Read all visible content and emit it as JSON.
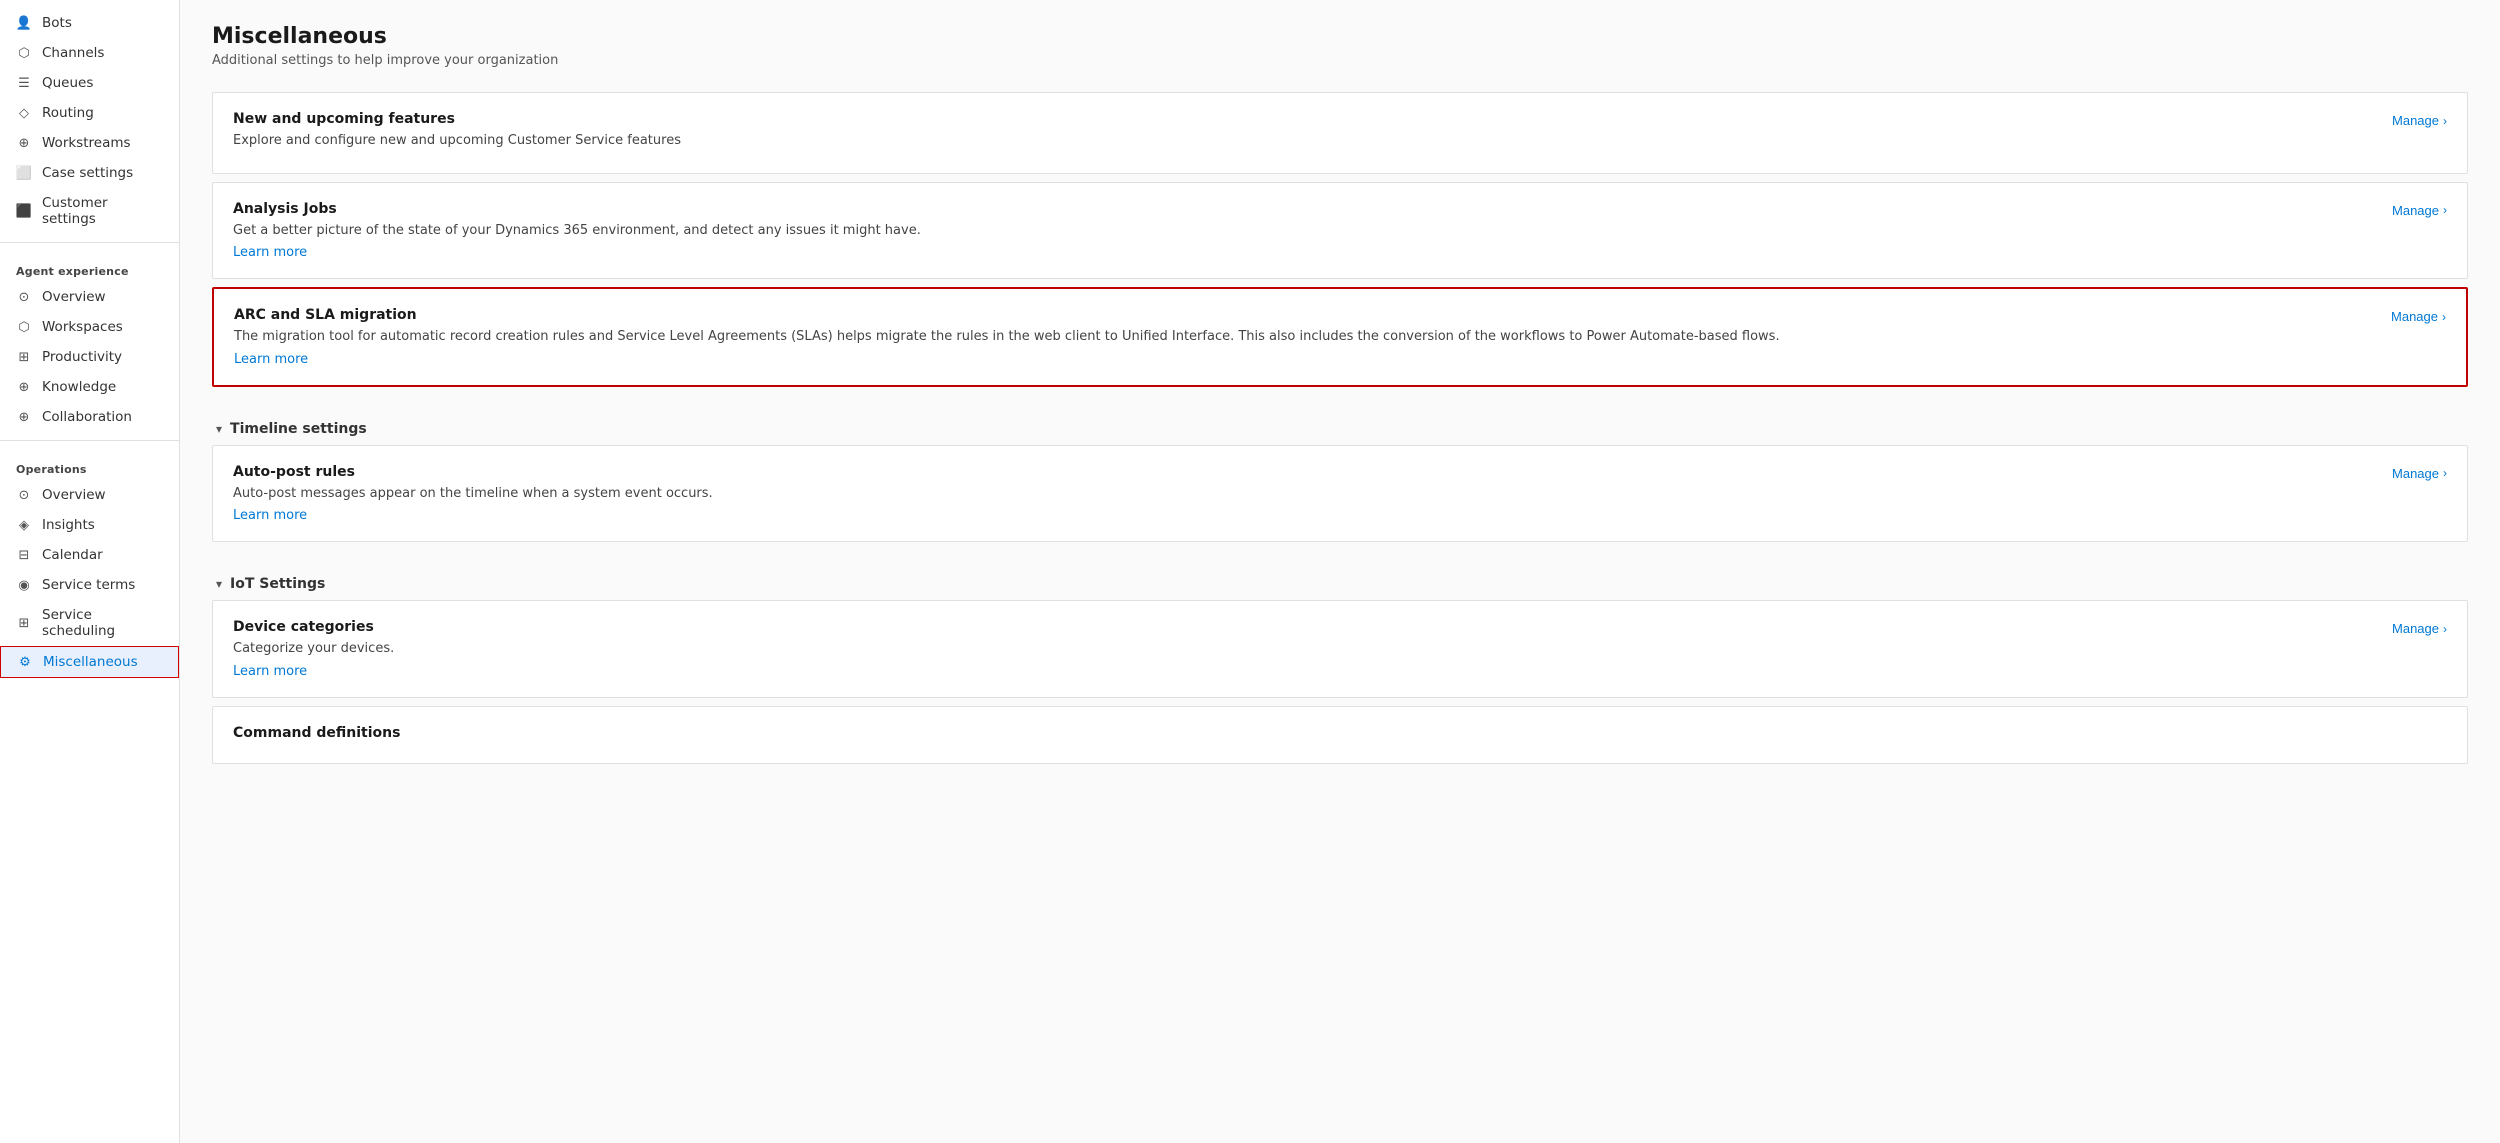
{
  "sidebar": {
    "topItems": [
      {
        "id": "bots",
        "label": "Bots",
        "icon": "👤"
      },
      {
        "id": "channels",
        "label": "Channels",
        "icon": "⬡"
      },
      {
        "id": "queues",
        "label": "Queues",
        "icon": "☰"
      },
      {
        "id": "routing",
        "label": "Routing",
        "icon": "◇"
      },
      {
        "id": "workstreams",
        "label": "Workstreams",
        "icon": "⊕"
      },
      {
        "id": "case-settings",
        "label": "Case settings",
        "icon": "⬜"
      },
      {
        "id": "customer-settings",
        "label": "Customer settings",
        "icon": "⬛"
      }
    ],
    "agentExperience": {
      "header": "Agent experience",
      "items": [
        {
          "id": "ae-overview",
          "label": "Overview",
          "icon": "⊙"
        },
        {
          "id": "ae-workspaces",
          "label": "Workspaces",
          "icon": "⬡"
        },
        {
          "id": "ae-productivity",
          "label": "Productivity",
          "icon": "⊞"
        },
        {
          "id": "ae-knowledge",
          "label": "Knowledge",
          "icon": "⊕"
        },
        {
          "id": "ae-collaboration",
          "label": "Collaboration",
          "icon": "⊕"
        }
      ]
    },
    "operations": {
      "header": "Operations",
      "items": [
        {
          "id": "op-overview",
          "label": "Overview",
          "icon": "⊙"
        },
        {
          "id": "op-insights",
          "label": "Insights",
          "icon": "◈"
        },
        {
          "id": "op-calendar",
          "label": "Calendar",
          "icon": "⊟"
        },
        {
          "id": "op-service-terms",
          "label": "Service terms",
          "icon": "◉"
        },
        {
          "id": "op-service-scheduling",
          "label": "Service scheduling",
          "icon": "⊞"
        },
        {
          "id": "op-miscellaneous",
          "label": "Miscellaneous",
          "icon": "⚙",
          "active": true
        }
      ]
    }
  },
  "page": {
    "title": "Miscellaneous",
    "subtitle": "Additional settings to help improve your organization"
  },
  "cards": [
    {
      "id": "new-upcoming",
      "title": "New and upcoming features",
      "desc": "Explore and configure new and upcoming Customer Service features",
      "link": null,
      "manage": "Manage"
    },
    {
      "id": "analysis-jobs",
      "title": "Analysis Jobs",
      "desc": "Get a better picture of the state of your Dynamics 365 environment, and detect any issues it might have.",
      "link": "Learn more",
      "manage": "Manage",
      "highlighted": false
    },
    {
      "id": "arc-sla",
      "title": "ARC and SLA migration",
      "desc": "The migration tool for automatic record creation rules and Service Level Agreements (SLAs) helps migrate the rules in the web client to Unified Interface. This also includes the conversion of the workflows to Power Automate-based flows.",
      "link": "Learn more",
      "manage": "Manage",
      "highlighted": true
    }
  ],
  "timelineSection": {
    "header": "Timeline settings",
    "cards": [
      {
        "id": "auto-post",
        "title": "Auto-post rules",
        "desc": "Auto-post messages appear on the timeline when a system event occurs.",
        "link": "Learn more",
        "manage": "Manage"
      }
    ]
  },
  "iotSection": {
    "header": "IoT Settings",
    "cards": [
      {
        "id": "device-categories",
        "title": "Device categories",
        "desc": "Categorize your devices.",
        "link": "Learn more",
        "manage": "Manage"
      },
      {
        "id": "command-definitions",
        "title": "Command definitions",
        "desc": "",
        "link": null,
        "manage": null
      }
    ]
  },
  "labels": {
    "manage": "Manage",
    "learn_more": "Learn more",
    "chevron": "›"
  }
}
